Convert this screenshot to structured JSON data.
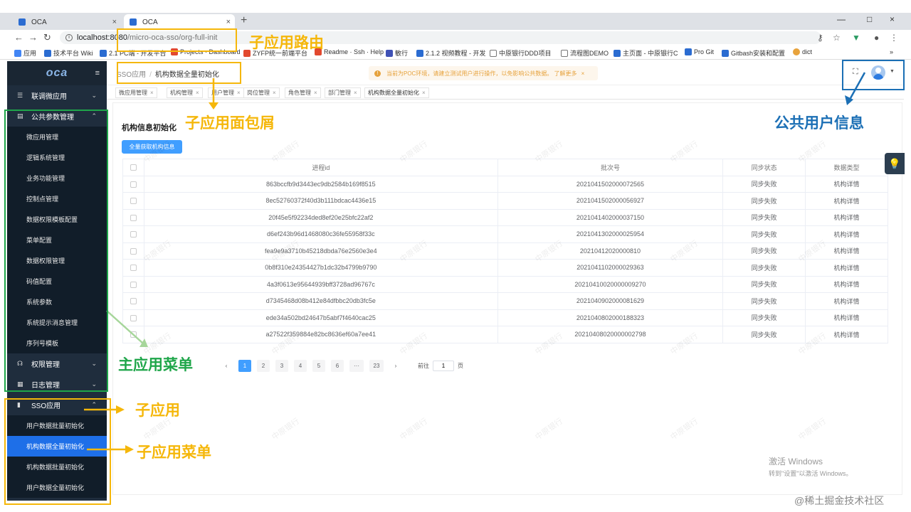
{
  "browser": {
    "tabs": [
      {
        "title": "OCA",
        "close": "×"
      },
      {
        "title": "OCA",
        "close": "×"
      }
    ],
    "new_tab": "+",
    "window_controls": [
      "—",
      "□",
      "×"
    ],
    "url_host": "localhost:8080",
    "url_path": "/micro-oca-sso/org-full-init",
    "bookmarks": [
      {
        "label": "应用",
        "color": "#4285f4"
      },
      {
        "label": "技术平台 Wiki",
        "color": "#2b6cd1"
      },
      {
        "label": "2.1 PC端 - 开发平台",
        "color": "#2b6cd1"
      },
      {
        "label": "Projects · Dashboard",
        "color": "#e2492f"
      },
      {
        "label": "ZYFP统一前端平台",
        "color": "#e2492f"
      },
      {
        "label": "Readme · Ssh · Help",
        "color": "#e2492f"
      },
      {
        "label": "敏行",
        "color": "#3f51b5"
      },
      {
        "label": "2.1.2 视频教程 - 开发",
        "color": "#2b6cd1"
      },
      {
        "label": "中原银行DDD项目",
        "color": "#777777"
      },
      {
        "label": "流程图DEMO",
        "color": "#777777"
      },
      {
        "label": "主页面 - 中原银行C",
        "color": "#2b6cd1"
      },
      {
        "label": "Pro Git",
        "color": "#2b6cd1"
      },
      {
        "label": "Gitbash安装和配置",
        "color": "#2b6cd1"
      },
      {
        "label": "dict",
        "color": "#e8a33c"
      }
    ],
    "more": "»"
  },
  "sidebar": {
    "logo": "oca",
    "fold_icon": "≡",
    "groups": [
      {
        "label": "联调微应用",
        "icon": "☰",
        "chev": "⌄",
        "items": []
      },
      {
        "label": "公共参数管理",
        "icon": "▤",
        "chev": "⌃",
        "items": [
          "微应用管理",
          "逻辑系统管理",
          "业务功能管理",
          "控制点管理",
          "数据权限模板配置",
          "菜单配置",
          "数据权限管理",
          "码值配置",
          "系统参数",
          "系统提示消息管理",
          "序列号模板"
        ]
      },
      {
        "label": "权限管理",
        "icon": "☊",
        "chev": "⌄",
        "items": []
      },
      {
        "label": "日志管理",
        "icon": "▦",
        "chev": "⌄",
        "items": []
      },
      {
        "label": "SSO应用",
        "icon": "▮",
        "chev": "⌃",
        "items": [
          "用户数据批量初始化",
          "机构数据全量初始化",
          "机构数据批量初始化",
          "用户数据全量初始化"
        ]
      }
    ],
    "active_item": "机构数据全量初始化"
  },
  "header": {
    "breadcrumb": [
      "SSO应用",
      "机构数据全量初始化"
    ],
    "breadcrumb_sep": "/",
    "notice": "当前为POC环境，请建立测试用户进行操作，以免影响公共数据。 了解更多",
    "notice_close": "×"
  },
  "tags": [
    {
      "label": "微应用管理",
      "close": "×"
    },
    {
      "label": "机构管理",
      "close": "×"
    },
    {
      "label": "用户管理",
      "close": "×"
    },
    {
      "label": "岗位管理",
      "close": "×"
    },
    {
      "label": "角色管理",
      "close": "×"
    },
    {
      "label": "部门管理",
      "close": "×"
    },
    {
      "label": "机构数据全量初始化",
      "close": "×"
    }
  ],
  "page": {
    "title": "机构信息初始化",
    "fetch_button": "全量获取机构信息",
    "columns": [
      "进程id",
      "批次号",
      "同步状态",
      "数据类型"
    ],
    "rows": [
      [
        "863bccfb9d3443ec9db2584b169f8515",
        "2021041502000072565",
        "同步失败",
        "机构详情"
      ],
      [
        "8ec52760372f40d3b111bdcac4436e15",
        "2021041502000056927",
        "同步失败",
        "机构详情"
      ],
      [
        "20f45e5f92234ded8ef20e25bfc22af2",
        "2021041402000037150",
        "同步失败",
        "机构详情"
      ],
      [
        "d6ef243b96d1468080c36fe55958f33c",
        "2021041302000025954",
        "同步失败",
        "机构详情"
      ],
      [
        "fea9e9a3710b45218dbda76e2560e3e4",
        "20210412020000810",
        "同步失败",
        "机构详情"
      ],
      [
        "0b8f310e24354427b1dc32b4799b9790",
        "2021041102000029363",
        "同步失败",
        "机构详情"
      ],
      [
        "4a3f0613e95644939bff3728ad96767c",
        "20210410020000009270",
        "同步失败",
        "机构详情"
      ],
      [
        "d7345468d08b412e84dfbbc20db3fc5e",
        "2021040902000081629",
        "同步失败",
        "机构详情"
      ],
      [
        "ede34a502bd24647b5abf7f4640cac25",
        "2021040802000188323",
        "同步失败",
        "机构详情"
      ],
      [
        "a27522f359884e82bc8636ef60a7ee41",
        "20210408020000002798",
        "同步失败",
        "机构详情"
      ]
    ],
    "watermark": "中原银行"
  },
  "pager": {
    "prev": "‹",
    "next": "›",
    "pages": [
      "1",
      "2",
      "3",
      "4",
      "5",
      "6",
      "···",
      "23"
    ],
    "current": "1",
    "goto_label": "前往",
    "goto_value": "1",
    "goto_suffix": "页"
  },
  "overlay_labels": {
    "route": "子应用路由",
    "breadcrumb": "子应用面包屑",
    "user_info": "公共用户信息",
    "main_menu": "主应用菜单",
    "sub_app": "子应用",
    "sub_menu": "子应用菜单"
  },
  "windows_activation": [
    "激活 Windows",
    "转到\"设置\"以激活 Windows。"
  ],
  "site_watermark": "@稀土掘金技术社区",
  "colors": {
    "accent": "#409eff",
    "sidebar_bg": "#1f2d3d",
    "annotation_yellow": "#f5b70a",
    "annotation_green": "#1fa64a",
    "annotation_blue": "#1b6fb5"
  }
}
